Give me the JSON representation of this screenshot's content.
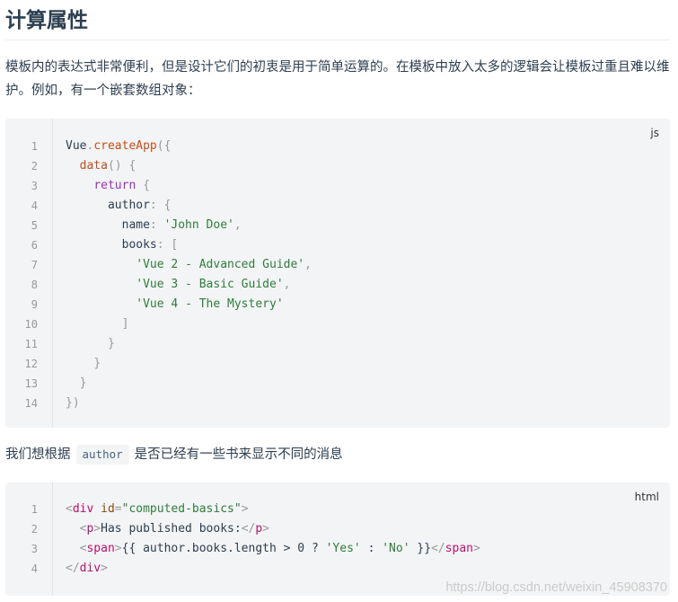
{
  "title": "计算属性",
  "intro": "模板内的表达式非常便利，但是设计它们的初衷是用于简单运算的。在模板中放入太多的逻辑会让模板过重且难以维护。例如，有一个嵌套数组对象：",
  "code1": {
    "lang": "js",
    "line_numbers": [
      "1",
      "2",
      "3",
      "4",
      "5",
      "6",
      "7",
      "8",
      "9",
      "10",
      "11",
      "12",
      "13",
      "14"
    ]
  },
  "para2": {
    "before": "我们想根据",
    "code": "author",
    "after": "是否已经有一些书来显示不同的消息"
  },
  "code2": {
    "lang": "html",
    "line_numbers": [
      "1",
      "2",
      "3",
      "4"
    ]
  },
  "watermark": "https://blog.csdn.net/weixin_45908370"
}
